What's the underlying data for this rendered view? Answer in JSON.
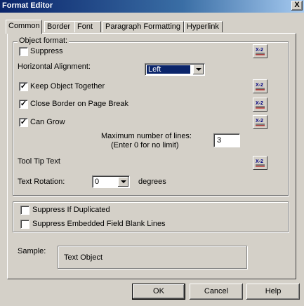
{
  "window": {
    "title": "Format Editor",
    "close_label": "X"
  },
  "tabs": [
    {
      "label": "Common"
    },
    {
      "label": "Border"
    },
    {
      "label": "Font"
    },
    {
      "label": "Paragraph Formatting"
    },
    {
      "label": "Hyperlink"
    }
  ],
  "object_format": {
    "group_label": "Object format:",
    "suppress": {
      "label": "Suppress",
      "checked": false
    },
    "horizontal_alignment": {
      "label": "Horizontal Alignment:",
      "value": "Left"
    },
    "keep_together": {
      "label": "Keep Object Together",
      "checked": true
    },
    "close_border": {
      "label": "Close Border on Page Break",
      "checked": true
    },
    "can_grow": {
      "label": "Can Grow",
      "checked": true
    },
    "max_lines": {
      "label_line1": "Maximum number of lines:",
      "label_line2": "(Enter 0 for no limit)",
      "value": "3"
    },
    "tooltip": {
      "label": "Tool Tip Text"
    },
    "text_rotation": {
      "label": "Text Rotation:",
      "value": "0",
      "unit": "degrees"
    },
    "formula_button_label": "X-2"
  },
  "suppress_group": {
    "if_duplicated": {
      "label": "Suppress If Duplicated",
      "checked": false
    },
    "embedded_blank": {
      "label": "Suppress Embedded Field Blank Lines",
      "checked": false
    }
  },
  "sample": {
    "label": "Sample:",
    "text": "Text Object"
  },
  "buttons": {
    "ok": "OK",
    "cancel": "Cancel",
    "help": "Help"
  },
  "colors": {
    "title_bar": "#0a246a",
    "face": "#d4d0c8",
    "selection": "#0a246a"
  }
}
